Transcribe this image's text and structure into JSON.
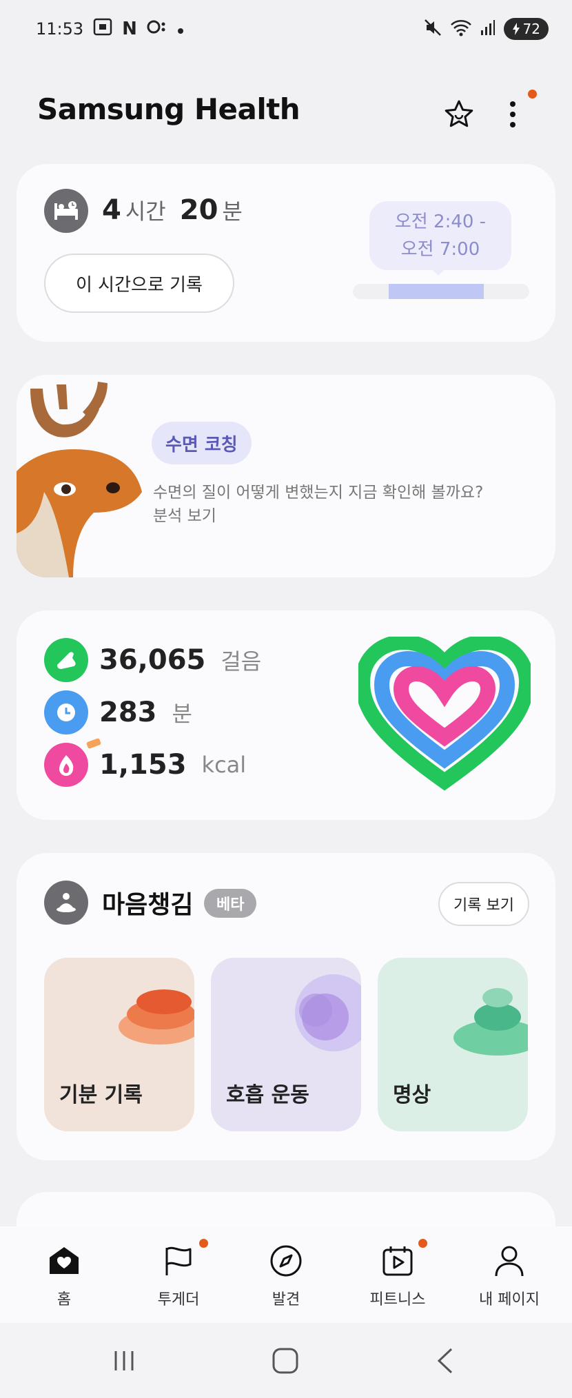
{
  "status_bar": {
    "time": "11:53",
    "left_icons": [
      "screenshot-icon",
      "n-icon",
      "chat-icon",
      "dot-icon"
    ],
    "battery_percent": "72",
    "right_icons": [
      "mute-icon",
      "wifi-icon",
      "signal-icon",
      "battery-icon"
    ]
  },
  "app": {
    "title": "Samsung Health"
  },
  "sleep": {
    "hours": "4",
    "hours_unit": "시간",
    "minutes": "20",
    "minutes_unit": "분",
    "record_button": "이 시간으로 기록",
    "bubble_line1": "오전 2:40 -",
    "bubble_line2": "오전 7:00"
  },
  "coaching": {
    "chip": "수면 코칭",
    "line1": "수면의 질이 어떻게 변했는지 지금 확인해 볼까요?",
    "line2": "분석 보기"
  },
  "activity": {
    "steps_value": "36,065",
    "steps_unit": "걸음",
    "minutes_value": "283",
    "minutes_unit": "분",
    "kcal_value": "1,153",
    "kcal_unit": "kcal"
  },
  "mind": {
    "title": "마음챙김",
    "badge": "베타",
    "history_button": "기록 보기",
    "tiles": [
      {
        "label": "기분 기록"
      },
      {
        "label": "호흡 운동"
      },
      {
        "label": "명상"
      }
    ]
  },
  "bottom_nav": [
    {
      "label": "홈",
      "icon": "home-icon",
      "badge": false
    },
    {
      "label": "투게더",
      "icon": "flag-icon",
      "badge": true
    },
    {
      "label": "발견",
      "icon": "compass-icon",
      "badge": false
    },
    {
      "label": "피트니스",
      "icon": "video-calendar-icon",
      "badge": true
    },
    {
      "label": "내 페이지",
      "icon": "person-icon",
      "badge": false
    }
  ],
  "colors": {
    "accent_orange": "#e45a1c",
    "steps_green": "#22c65a",
    "minutes_blue": "#4a9cf0",
    "kcal_pink": "#f04aa0",
    "coach_purple": "#5a5ab4"
  }
}
